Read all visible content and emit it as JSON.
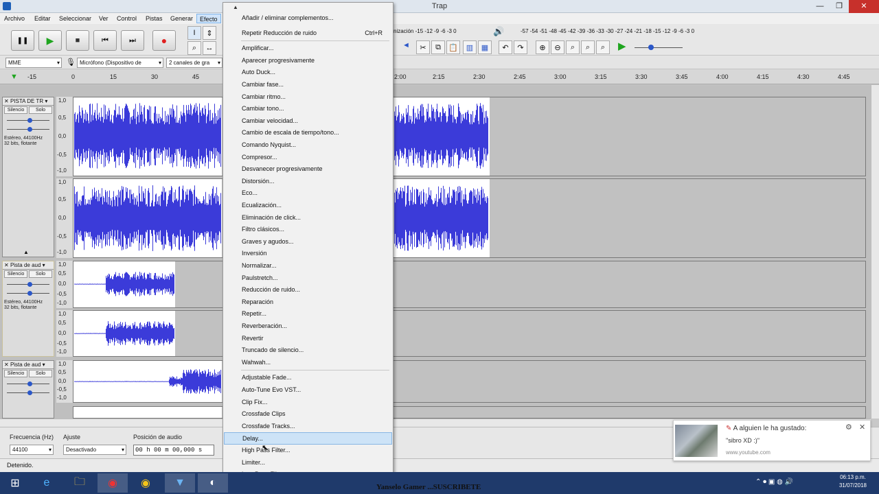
{
  "window": {
    "title": "Trap",
    "min": "—",
    "max": "❐",
    "close": "✕"
  },
  "menubar": [
    "Archivo",
    "Editar",
    "Seleccionar",
    "Ver",
    "Control",
    "Pistas",
    "Generar",
    "Efecto"
  ],
  "transport": {
    "pause": "❚❚",
    "play": "▶",
    "stop": "■",
    "skip_start": "⏮",
    "skip_end": "⏭",
    "record": "●"
  },
  "meters": {
    "rec_scale": "nización -15 -12 -9 -6 -3 0",
    "play_scale": "-57 -54 -51 -48 -45 -42 -39 -36 -33 -30 -27 -24 -21 -18 -15 -12 -9 -6 -3 0"
  },
  "device": {
    "host": "MME",
    "mic": "Micrófono (Dispositivo de",
    "channels": "2 canales de gra"
  },
  "ruler_ticks": [
    "-15",
    "0",
    "15",
    "30",
    "45",
    "2:00",
    "2:15",
    "2:30",
    "2:45",
    "3:00",
    "3:15",
    "3:30",
    "3:45",
    "4:00",
    "4:15",
    "4:30",
    "4:45"
  ],
  "tracks": [
    {
      "name": "PISTA DE TR",
      "mute": "Silencio",
      "solo": "Solo",
      "info1": "Estéreo, 44100Hz",
      "info2": "32 bits, flotante",
      "scale": [
        "1,0",
        "0,5",
        "0,0",
        "-0,5",
        "-1,0"
      ]
    },
    {
      "name": "Pista de aud",
      "mute": "Silencio",
      "solo": "Solo",
      "info1": "Estéreo, 44100Hz",
      "info2": "32 bits, flotante",
      "scale": [
        "1,0",
        "0,5",
        "0,0",
        "-0,5",
        "-1,0"
      ]
    },
    {
      "name": "Pista de aud",
      "mute": "Silencio",
      "solo": "Solo",
      "info1": "",
      "info2": "",
      "scale": [
        "1,0",
        "0,5",
        "0,0",
        "-0,5",
        "-1,0"
      ]
    }
  ],
  "selection": {
    "rate_label": "Frecuencia (Hz)",
    "rate_value": "44100",
    "snap_label": "Ajuste",
    "snap_value": "Desactivado",
    "pos_label": "Posición de audio",
    "pos_value": "00 h 00 m 00,000 s"
  },
  "status": "Detenido.",
  "effect_menu": {
    "top": [
      {
        "label": "Añadir / eliminar complementos...",
        "accel": ""
      },
      {
        "label": "Repetir Reducción de ruido",
        "accel": "Ctrl+R"
      }
    ],
    "builtin": [
      "Amplificar...",
      "Aparecer progresivamente",
      "Auto Duck...",
      "Cambiar fase...",
      "Cambiar ritmo...",
      "Cambiar tono...",
      "Cambiar velocidad...",
      "Cambio de escala de tiempo/tono...",
      "Comando Nyquist...",
      "Compresor...",
      "Desvanecer progresivamente",
      "Distorsión...",
      "Eco...",
      "Ecualización...",
      "Eliminación de click...",
      "Filtro clásicos...",
      "Graves y agudos...",
      "Inversión",
      "Normalizar...",
      "Paulstretch...",
      "Reducción de ruido...",
      "Reparación",
      "Repetir...",
      "Reverberación...",
      "Revertir",
      "Truncado de silencio...",
      "Wahwah..."
    ],
    "plugins": [
      "Adjustable Fade...",
      "Auto-Tune Evo VST...",
      "Clip Fix...",
      "Crossfade Clips",
      "Crossfade Tracks...",
      "Delay...",
      "High Pass Filter...",
      "Limiter...",
      "Low Pass Filter..."
    ],
    "highlighted": "Delay...",
    "scroll_up": "▲",
    "scroll_down": "▼"
  },
  "notification": {
    "title": "A alguien le ha gustado:",
    "body": "\"sibro XD :)\"",
    "source": "www.youtube.com",
    "gear": "⚙",
    "close": "✕"
  },
  "taskbar": {
    "caption": "Yanselo Gamer ...SUSCRIBETE",
    "time": "06:13 p.m.",
    "date": "31/07/2018"
  },
  "colors": {
    "wave": "#3b3bd9",
    "menu_highlight": "#cde3f7",
    "record": "#e02020",
    "play": "#1fa51f"
  }
}
